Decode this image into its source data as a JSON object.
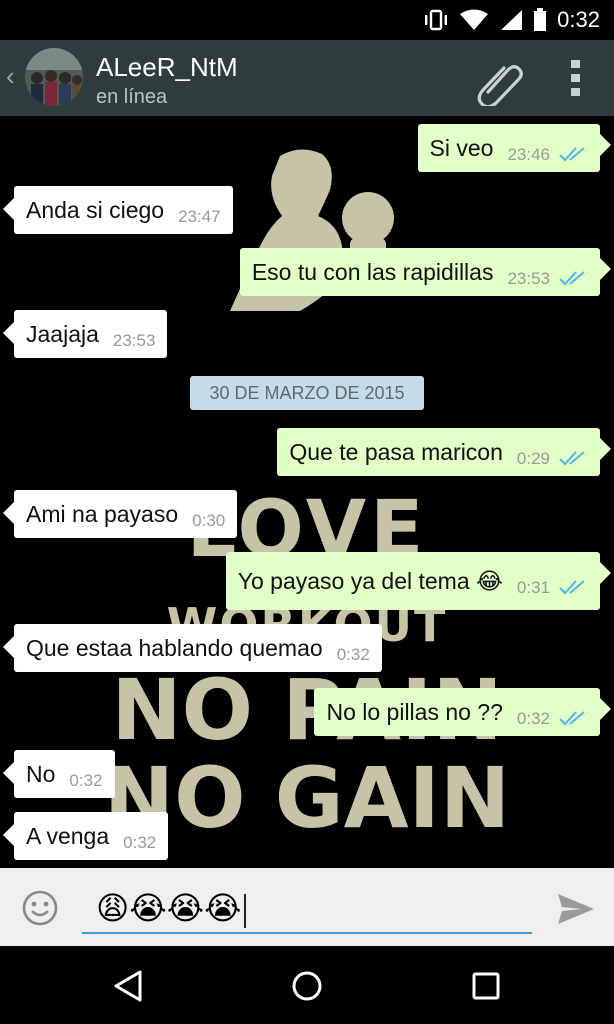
{
  "status_bar": {
    "time": "0:32",
    "icons": [
      "vibrate-icon",
      "wifi-icon",
      "signal-icon",
      "battery-icon"
    ]
  },
  "header": {
    "back_icon": "chevron-left-icon",
    "contact_name": "ALeeR_NtM",
    "status": "en línea",
    "attach_icon": "paperclip-icon",
    "menu_icon": "overflow-menu-icon"
  },
  "wallpaper": {
    "lines": [
      "LOVE",
      "WORKOUT",
      "NO PAIN",
      "NO GAIN"
    ]
  },
  "messages": [
    {
      "dir": "out",
      "text": "Si veo",
      "time": "23:46",
      "status": "read"
    },
    {
      "dir": "in",
      "text": "Anda si ciego",
      "time": "23:47"
    },
    {
      "dir": "out",
      "text": "Eso tu con las rapidillas",
      "time": "23:53",
      "status": "read"
    },
    {
      "dir": "in",
      "text": "Jaajaja",
      "time": "23:53"
    },
    {
      "dir": "date",
      "text": "30 DE MARZO DE 2015"
    },
    {
      "dir": "out",
      "text": "Que te pasa maricon",
      "time": "0:29",
      "status": "read"
    },
    {
      "dir": "in",
      "text": "Ami na payaso",
      "time": "0:30"
    },
    {
      "dir": "out",
      "text": "Yo payaso ya del tema 😂",
      "time": "0:31",
      "status": "read"
    },
    {
      "dir": "in",
      "text": "Que estaa hablando quemao",
      "time": "0:32"
    },
    {
      "dir": "out",
      "text": "No lo pillas no ??",
      "time": "0:32",
      "status": "read"
    },
    {
      "dir": "in",
      "text": "No",
      "time": "0:32"
    },
    {
      "dir": "in",
      "text": "A venga",
      "time": "0:32"
    }
  ],
  "composer": {
    "emoji_icon": "smiley-icon",
    "draft": "😩😭😭😭",
    "send_icon": "send-icon"
  },
  "nav": {
    "back": "back-triangle-icon",
    "home": "home-circle-icon",
    "recents": "recents-square-icon"
  },
  "colors": {
    "header": "#2f3c3e",
    "incoming": "#ffffff",
    "outgoing": "#e1ffc7",
    "read_ticks": "#4fb8e6",
    "date_chip": "#c5dbe8"
  }
}
